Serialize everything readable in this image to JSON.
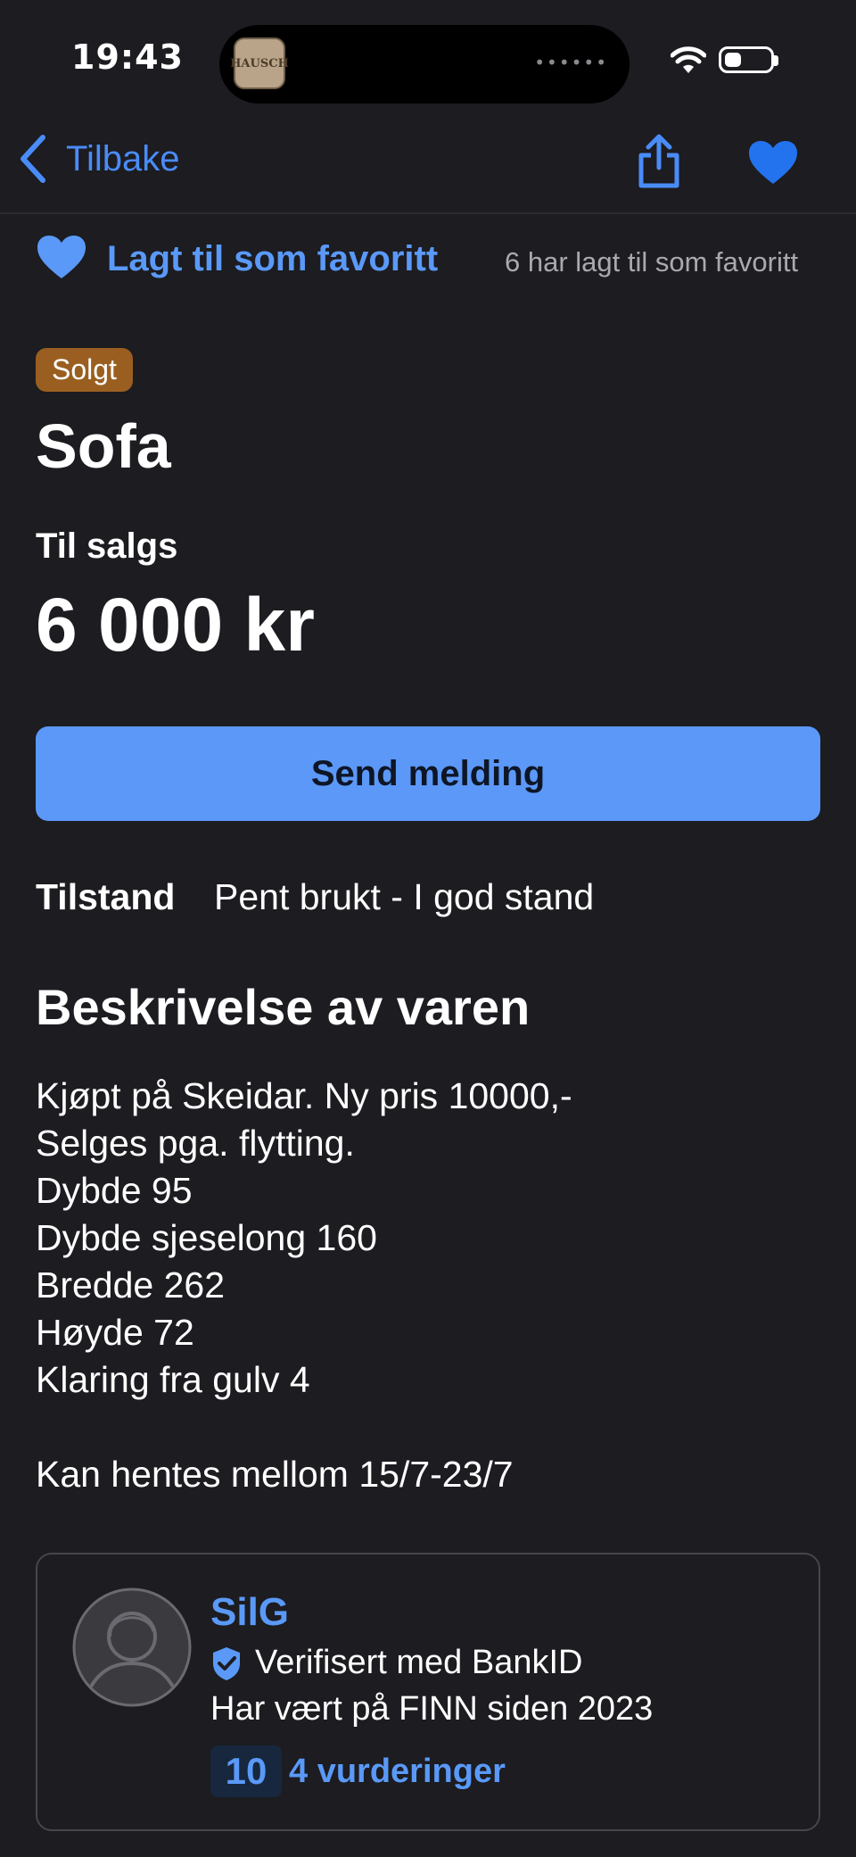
{
  "status_bar": {
    "time": "19:43",
    "island_app_label": "HAUSCH",
    "island_dots": "••••••"
  },
  "nav": {
    "back_label": "Tilbake",
    "icons": [
      "chevron-left-icon",
      "share-icon",
      "heart-filled-icon"
    ]
  },
  "favorite": {
    "label": "Lagt til som favoritt",
    "count_text": "6 har lagt til som favoritt"
  },
  "listing": {
    "status_badge": "Solgt",
    "title": "Sofa",
    "sale_type": "Til salgs",
    "price": "6 000 kr",
    "send_button_label": "Send melding",
    "condition_label": "Tilstand",
    "condition_value": "Pent brukt - I god stand",
    "description_heading": "Beskrivelse av varen",
    "description_lines": [
      "Kjøpt på Skeidar. Ny pris 10000,-",
      "Selges pga. flytting.",
      "Dybde 95",
      "Dybde sjeselong 160",
      "Bredde 262",
      "Høyde 72",
      "Klaring fra gulv 4",
      "",
      "Kan hentes mellom 15/7-23/7"
    ]
  },
  "seller": {
    "name": "SilG",
    "verified_text": "Verifisert med BankID",
    "member_since": "Har vært på FINN siden 2023",
    "score": "10",
    "reviews_text": "4 vurderinger"
  },
  "colors": {
    "background": "#1c1c21",
    "accent": "#5b98f8",
    "sold_badge": "#9a5f20",
    "text": "#ffffff",
    "muted": "#a9a9ae"
  }
}
